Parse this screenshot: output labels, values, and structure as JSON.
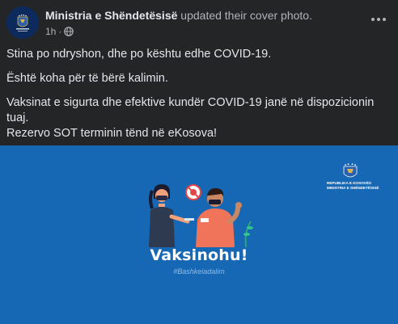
{
  "post": {
    "author": "Ministria e Shëndetësisë",
    "action": " updated their cover photo.",
    "time": "1h",
    "dot": " · ",
    "lines": [
      "Stina po ndryshon, dhe po kështu edhe COVID-19.",
      "Është koha për të bërë kalimin.",
      "Vaksinat e sigurta dhe efektive kundër COVID-19 janë në dispozicionin tuaj.",
      "Rezervo SOT terminin tënd në eKosova!"
    ]
  },
  "cover": {
    "title": "Vaksinohu!",
    "hashtag": "#Bashkeiadalim",
    "logo_line1": "REPUBLIKA E KOSOVËS",
    "logo_line2": "MINISTRIA E SHËNDETËSISË"
  },
  "colors": {
    "background": "#242526",
    "cover": "#1667b4",
    "text": "#e4e6eb",
    "secondary": "#b0b3b8"
  },
  "icons": {
    "privacy": "globe-icon",
    "menu": "more-icon"
  }
}
